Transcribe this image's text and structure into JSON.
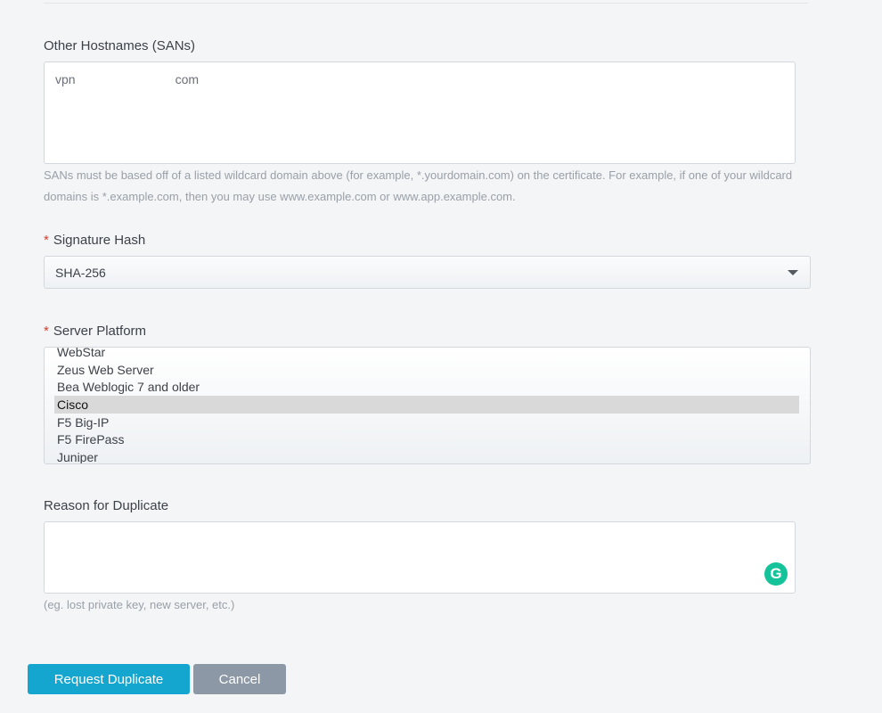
{
  "sans": {
    "label": "Other Hostnames (SANs)",
    "value_prefix": "vpn",
    "value_suffix": "com",
    "help": "SANs must be based off of a listed wildcard domain above (for example, *.yourdomain.com) on the certificate. For example, if one of your wildcard domains is *.example.com, then you may use www.example.com or www.app.example.com."
  },
  "signature_hash": {
    "required_mark": "*",
    "label": "Signature Hash",
    "selected": "SHA-256"
  },
  "server_platform": {
    "required_mark": "*",
    "label": "Server Platform",
    "options": [
      "WebStar",
      "Zeus Web Server",
      "Bea Weblogic 7 and older",
      "Cisco",
      "F5 Big-IP",
      "F5 FirePass",
      "Juniper"
    ],
    "selected": "Cisco"
  },
  "reason": {
    "label": "Reason for Duplicate",
    "value": "",
    "help": "(eg. lost private key, new server, etc.)",
    "grammarly_glyph": "G"
  },
  "actions": {
    "submit": "Request Duplicate",
    "cancel": "Cancel"
  }
}
